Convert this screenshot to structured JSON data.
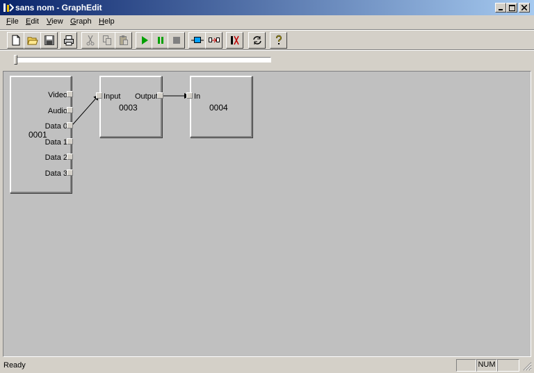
{
  "window": {
    "title": "sans nom - GraphEdit"
  },
  "menu": [
    {
      "mnemonic": "F",
      "rest": "ile"
    },
    {
      "mnemonic": "E",
      "rest": "dit"
    },
    {
      "mnemonic": "V",
      "rest": "iew"
    },
    {
      "mnemonic": "G",
      "rest": "raph"
    },
    {
      "mnemonic": "H",
      "rest": "elp"
    }
  ],
  "toolbar": [
    {
      "icon": "new-file-icon"
    },
    {
      "icon": "open-folder-icon"
    },
    {
      "icon": "save-icon"
    },
    {
      "icon": "print-icon"
    },
    {
      "icon": "cut-icon"
    },
    {
      "icon": "copy-icon"
    },
    {
      "icon": "paste-icon"
    },
    {
      "icon": "play-icon"
    },
    {
      "icon": "pause-icon"
    },
    {
      "icon": "stop-icon"
    },
    {
      "icon": "render-pin-icon"
    },
    {
      "icon": "connect-filters-icon"
    },
    {
      "icon": "sync-clock-icon"
    },
    {
      "icon": "refresh-icon"
    },
    {
      "icon": "help-icon"
    }
  ],
  "seek": {
    "position": 0
  },
  "filters": {
    "f0001": {
      "id": "0001",
      "pins": [
        "Video",
        "Audio",
        "Data 0",
        "Data 1",
        "Data 2",
        "Data 3"
      ]
    },
    "f0003": {
      "id": "0003",
      "input": "Input",
      "output": "Output"
    },
    "f0004": {
      "id": "0004",
      "input": "In"
    }
  },
  "status": {
    "text": "Ready",
    "num": "NUM"
  },
  "colors": {
    "title_start": "#0a246a",
    "title_end": "#a6caf0",
    "play": "#00a000",
    "canvas": "#c0c0c0"
  }
}
